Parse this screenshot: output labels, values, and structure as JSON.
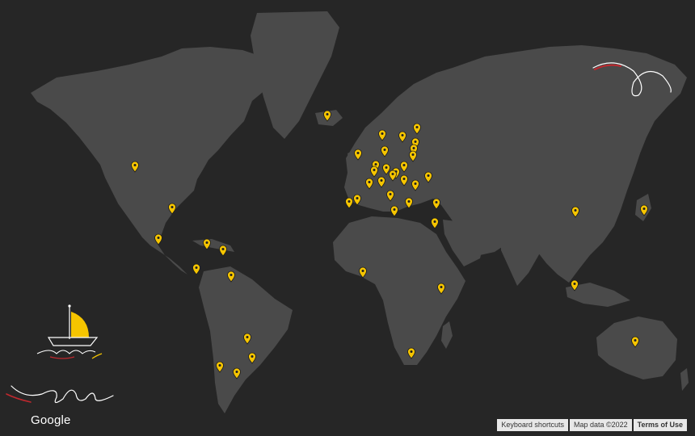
{
  "map": {
    "background": "#262626",
    "land_color": "#4a4a4a",
    "marker_color": "#f6c500",
    "marker_count": 52,
    "markers_by_region": {
      "north_america": 9,
      "south_america": 5,
      "europe": 27,
      "africa": 4,
      "asia": 4,
      "oceania": 1,
      "iceland": 1
    }
  },
  "branding": {
    "logo_text": "Google"
  },
  "attribution": {
    "keyboard_shortcuts": "Keyboard shortcuts",
    "map_data": "Map data ©2022",
    "terms": "Terms of Use"
  },
  "decorations": {
    "sailboat_color": "#f6c500",
    "accent_red": "#c0282e",
    "line_color": "#ffffff"
  }
}
